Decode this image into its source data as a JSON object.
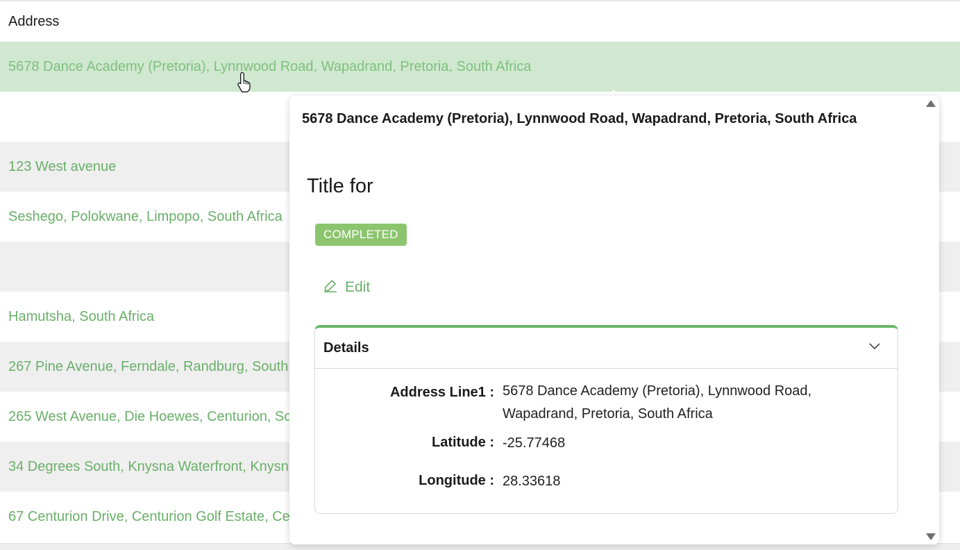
{
  "table": {
    "header": "Address",
    "rows": [
      "5678 Dance Academy (Pretoria), Lynnwood Road, Wapadrand, Pretoria, South Africa",
      "",
      "123 West avenue",
      "Seshego, Polokwane, Limpopo, South Africa",
      "",
      "Hamutsha, South Africa",
      "267 Pine Avenue, Ferndale, Randburg, South",
      "265 West Avenue, Die Hoewes, Centurion, So",
      "34 Degrees South, Knysna Waterfront, Knysn",
      "67 Centurion Drive, Centurion Golf Estate, Ce"
    ]
  },
  "popover": {
    "heading": "5678 Dance Academy (Pretoria), Lynnwood Road, Wapadrand, Pretoria, South Africa",
    "title": "Title for",
    "status": "COMPLETED",
    "edit_label": "Edit",
    "details": {
      "title": "Details",
      "fields": [
        {
          "label": "Address Line1",
          "value_line1": "5678 Dance Academy (Pretoria), Lynnwood Road,",
          "value_line2": "Wapadrand, Pretoria, South Africa"
        },
        {
          "label": "Latitude",
          "value": "-25.77468"
        },
        {
          "label": "Longitude",
          "value": "28.33618"
        }
      ]
    }
  },
  "colors": {
    "accent": "#6aaf6a",
    "selected_row": "#cfe8cf",
    "badge": "#8cc56e"
  },
  "icons": {
    "edit": "pencil-icon",
    "expand": "chevron-down-icon",
    "cursor": "hand-pointer-icon"
  }
}
